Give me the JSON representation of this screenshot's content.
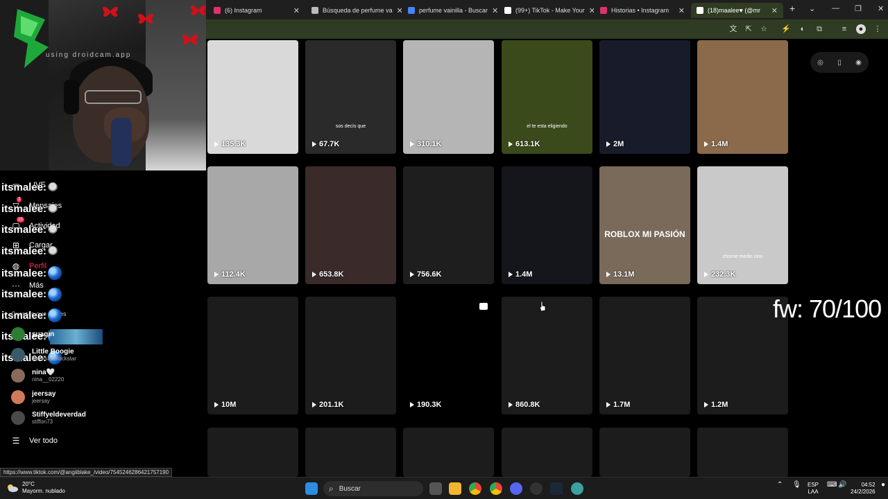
{
  "browser": {
    "tabs": [
      {
        "label": "(6) Instagram",
        "color": "#e1306c"
      },
      {
        "label": "Búsqueda de perfume va",
        "color": "#bbbbbb"
      },
      {
        "label": "perfume vainilla - Buscar",
        "color": "#4285f4"
      },
      {
        "label": "(99+) TikTok - Make Your",
        "color": "#ffffff"
      },
      {
        "label": "Historias • Instagram",
        "color": "#e1306c"
      },
      {
        "label": "(18)maalee♥ (@mr",
        "color": "#ffffff"
      }
    ],
    "new_tab_label": "+",
    "window_controls": [
      "⌄",
      "—",
      "❐",
      "✕"
    ]
  },
  "webcam": {
    "watermark": "using droidcam.app"
  },
  "sidebar": {
    "nav": [
      {
        "label": "LIVE",
        "icon": "live-icon"
      },
      {
        "label": "Mensajes",
        "icon": "inbox-icon",
        "badge": "3"
      },
      {
        "label": "Actividad",
        "icon": "activity-icon",
        "badge": "15"
      },
      {
        "label": "Cargar",
        "icon": "upload-icon"
      },
      {
        "label": "Perfil",
        "icon": "profile-icon"
      },
      {
        "label": "Más",
        "icon": "more-icon"
      }
    ],
    "section_title": "Cuentas que sigues",
    "spam_text": "itsmalee:",
    "spam_count": 9,
    "following": [
      {
        "name": "suagin",
        "handle": "",
        "color": "#2e7d32"
      },
      {
        "name": "Little Boogie",
        "handle": "blockstarblockstar",
        "color": "#3a5a6a"
      },
      {
        "name": "nina🤍",
        "handle": "nina__02220",
        "color": "#8a6a5a"
      },
      {
        "name": "jeersay",
        "handle": "jeersay",
        "color": "#d07a5a"
      },
      {
        "name": "Stiffyeldeverdad",
        "handle": "stiffon73",
        "color": "#4a4a4a"
      }
    ],
    "see_all": "Ver todo"
  },
  "grid": {
    "rows": [
      [
        {
          "views": "135.3K",
          "overlay": "",
          "bg": "#d9d9d9"
        },
        {
          "views": "67.7K",
          "overlay": "sos decís que",
          "bg": "#2a2a2a"
        },
        {
          "views": "310.1K",
          "overlay": "",
          "bg": "#b5b5b5"
        },
        {
          "views": "613.1K",
          "overlay": "el te esta eligiendo",
          "bg": "#3a4a1a"
        },
        {
          "views": "2M",
          "overlay": "",
          "bg": "#181c2a"
        },
        {
          "views": "1.4M",
          "overlay": "",
          "bg": "#8a6a4a"
        }
      ],
      [
        {
          "views": "112.4K",
          "overlay": "",
          "bg": "#a8a8a8"
        },
        {
          "views": "653.8K",
          "overlay": "",
          "bg": "#3a2a2a"
        },
        {
          "views": "756.6K",
          "overlay": "",
          "bg": "#1e1e1e"
        },
        {
          "views": "1.4M",
          "overlay": "",
          "bg": "#15161c"
        },
        {
          "views": "13.1M",
          "overlay": "ROBLOX MI PASIÓN",
          "bg": "#7a6a5a"
        },
        {
          "views": "232.3K",
          "overlay": "chisme medio cino",
          "bg": "#c9c9c9"
        }
      ],
      [
        {
          "views": "10M",
          "overlay": "",
          "bg": "#1c1c1c"
        },
        {
          "views": "201.1K",
          "overlay": "",
          "bg": "#1c1c1c"
        },
        {
          "views": "190.3K",
          "overlay": "",
          "bg": "#000000"
        },
        {
          "views": "860.8K",
          "overlay": "",
          "bg": "#1c1c1c"
        },
        {
          "views": "1.7M",
          "overlay": "",
          "bg": "#1c1c1c"
        },
        {
          "views": "1.2M",
          "overlay": "",
          "bg": "#1c1c1c"
        }
      ],
      [
        {
          "views": "",
          "overlay": "",
          "bg": "#1c1c1c"
        },
        {
          "views": "",
          "overlay": "",
          "bg": "#1c1c1c"
        },
        {
          "views": "",
          "overlay": "",
          "bg": "#1c1c1c"
        },
        {
          "views": "",
          "overlay": "",
          "bg": "#1c1c1c"
        },
        {
          "views": "",
          "overlay": "",
          "bg": "#1c1c1c"
        },
        {
          "views": "",
          "overlay": "",
          "bg": "#1c1c1c"
        }
      ]
    ]
  },
  "overlay_text": "fw: 70/100",
  "status_url": "https://www.tiktok.com/@angiiblake_/video/7545246286421757190",
  "taskbar": {
    "weather_temp": "20°C",
    "weather_desc": "Mayorm. nublado",
    "search_label": "Buscar",
    "lang_top": "ESP",
    "lang_bottom": "LAA",
    "time": "04:52",
    "date": "24/2/2026"
  }
}
